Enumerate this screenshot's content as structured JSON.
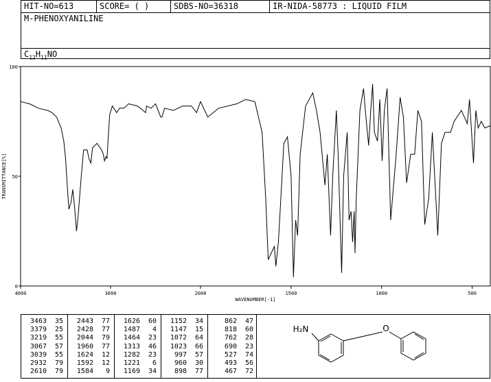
{
  "header": {
    "hit_no": "HIT-NO=613",
    "score": "SCORE=  (   )",
    "sdbs_no": "SDBS-NO=36318",
    "ir_info": "IR-NIDA-58773 : LIQUID FILM",
    "compound_name": "M-PHENOXYANILINE",
    "formula": {
      "c": "C",
      "c_n": "12",
      "h": "H",
      "h_n": "11",
      "rest": "NO"
    }
  },
  "chart_data": {
    "type": "line",
    "xlabel": "WAVENUMBER[-1]",
    "ylabel": "TRANSMITTANCE[%]",
    "xlim": [
      4000,
      400
    ],
    "ylim": [
      0,
      100
    ],
    "x_ticks": [
      4000,
      3000,
      2000,
      1500,
      1000,
      500
    ],
    "x_tick_labels": [
      "4000",
      "3000",
      "2000",
      "1500",
      "1000",
      "500"
    ],
    "y_ticks": [
      0,
      50,
      100
    ],
    "y_tick_labels": [
      "0",
      "50",
      "100"
    ],
    "x": [
      4000,
      3900,
      3800,
      3700,
      3650,
      3600,
      3550,
      3520,
      3500,
      3480,
      3463,
      3440,
      3420,
      3400,
      3379,
      3360,
      3330,
      3300,
      3260,
      3240,
      3219,
      3200,
      3150,
      3100,
      3080,
      3067,
      3050,
      3039,
      3030,
      3010,
      2980,
      2932,
      2900,
      2850,
      2800,
      2700,
      2610,
      2600,
      2550,
      2500,
      2443,
      2428,
      2400,
      2300,
      2200,
      2100,
      2044,
      2000,
      1960,
      1900,
      1800,
      1750,
      1700,
      1660,
      1640,
      1626,
      1610,
      1592,
      1584,
      1570,
      1560,
      1540,
      1520,
      1500,
      1487,
      1475,
      1464,
      1450,
      1420,
      1380,
      1360,
      1340,
      1313,
      1300,
      1282,
      1270,
      1250,
      1240,
      1221,
      1210,
      1190,
      1180,
      1169,
      1160,
      1152,
      1147,
      1140,
      1120,
      1100,
      1090,
      1072,
      1060,
      1050,
      1040,
      1023,
      1010,
      997,
      985,
      970,
      960,
      950,
      920,
      898,
      880,
      862,
      840,
      818,
      800,
      780,
      762,
      740,
      720,
      690,
      670,
      650,
      620,
      600,
      560,
      527,
      515,
      493,
      480,
      467,
      450,
      430,
      400
    ],
    "y": [
      84,
      83,
      81,
      80,
      79,
      77,
      72,
      66,
      58,
      45,
      35,
      38,
      44,
      36,
      25,
      32,
      48,
      62,
      62,
      58,
      56,
      63,
      65,
      62,
      60,
      57,
      59,
      58,
      65,
      78,
      82,
      79,
      81,
      81,
      83,
      82,
      79,
      82,
      81,
      83,
      77,
      77,
      81,
      80,
      82,
      82,
      79,
      84,
      77,
      81,
      83,
      85,
      84,
      70,
      40,
      12,
      15,
      18,
      9,
      20,
      35,
      65,
      68,
      50,
      4,
      30,
      23,
      60,
      82,
      88,
      80,
      70,
      46,
      60,
      23,
      50,
      80,
      60,
      6,
      50,
      70,
      30,
      34,
      20,
      34,
      15,
      40,
      80,
      90,
      80,
      64,
      80,
      92,
      70,
      66,
      85,
      57,
      80,
      90,
      60,
      30,
      60,
      86,
      77,
      47,
      60,
      60,
      80,
      75,
      28,
      40,
      70,
      23,
      65,
      70,
      70,
      75,
      80,
      74,
      85,
      56,
      80,
      72,
      75,
      72,
      73
    ]
  },
  "peak_table": {
    "columns": [
      [
        [
          "3463",
          "35"
        ],
        [
          "3379",
          "25"
        ],
        [
          "3219",
          "55"
        ],
        [
          "3067",
          "57"
        ],
        [
          "3039",
          "55"
        ],
        [
          "2932",
          "79"
        ],
        [
          "2610",
          "79"
        ]
      ],
      [
        [
          "2443",
          "77"
        ],
        [
          "2428",
          "77"
        ],
        [
          "2044",
          "79"
        ],
        [
          "1960",
          "77"
        ],
        [
          "1624",
          "12"
        ],
        [
          "1592",
          "12"
        ],
        [
          "1584",
          "9"
        ]
      ],
      [
        [
          "1626",
          "60"
        ],
        [
          "1487",
          "4"
        ],
        [
          "1464",
          "23"
        ],
        [
          "1313",
          "46"
        ],
        [
          "1282",
          "23"
        ],
        [
          "1221",
          "6"
        ],
        [
          "1169",
          "34"
        ]
      ],
      [
        [
          "1152",
          "34"
        ],
        [
          "1147",
          "15"
        ],
        [
          "1072",
          "64"
        ],
        [
          "1023",
          "66"
        ],
        [
          "997",
          "57"
        ],
        [
          "960",
          "30"
        ],
        [
          "898",
          "77"
        ]
      ],
      [
        [
          "862",
          "47"
        ],
        [
          "818",
          "60"
        ],
        [
          "762",
          "28"
        ],
        [
          "690",
          "23"
        ],
        [
          "527",
          "74"
        ],
        [
          "493",
          "56"
        ],
        [
          "467",
          "72"
        ]
      ]
    ]
  },
  "structure": {
    "amine_label": "H₂N",
    "oxygen_label": "O"
  }
}
